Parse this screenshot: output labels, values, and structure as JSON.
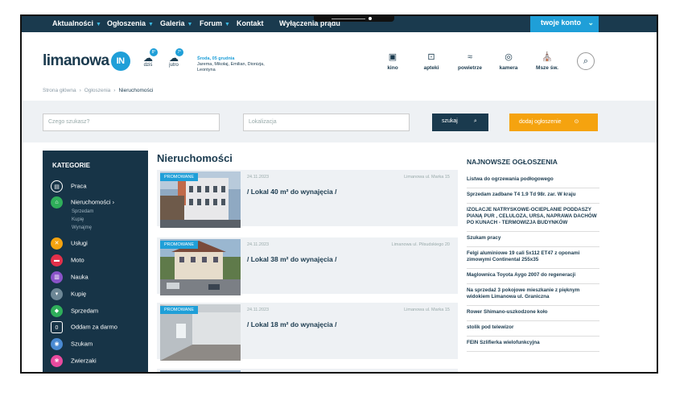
{
  "nav": {
    "items": [
      "Aktualności",
      "Ogłoszenia",
      "Galeria",
      "Forum",
      "Kontakt",
      "Wyłączenia prądu"
    ],
    "account": "twoje konto"
  },
  "header": {
    "logo_text": "limanowa",
    "logo_badge": "IN",
    "weather_today": {
      "label": "dziś",
      "temp": "8°"
    },
    "weather_tomorrow": {
      "label": "jutro",
      "temp": "7°"
    },
    "date": "Środa, 05 grudnia",
    "names": "Jarema, Mikołaj, Emilian, Dionizja, Leontyna",
    "icons": [
      {
        "label": "kino",
        "icon": "cinema-icon"
      },
      {
        "label": "apteki",
        "icon": "pharmacy-icon"
      },
      {
        "label": "powietrze",
        "icon": "air-icon"
      },
      {
        "label": "kamera",
        "icon": "camera-icon"
      },
      {
        "label": "Msze św.",
        "icon": "church-icon"
      }
    ]
  },
  "breadcrumb": {
    "home": "Strona główna",
    "section": "Ogłoszenia",
    "current": "Nieruchomości"
  },
  "search": {
    "query_placeholder": "Czego szukasz?",
    "location_placeholder": "Lokalizacja",
    "search_label": "szukaj",
    "add_label": "dodaj ogłoszenie"
  },
  "sidebar": {
    "title": "KATEGORIE",
    "items": [
      {
        "label": "Praca",
        "color": "#173447"
      },
      {
        "label": "Nieruchomości ›",
        "color": "#2fae5a"
      },
      {
        "label": "Usługi",
        "color": "#f5a30f"
      },
      {
        "label": "Moto",
        "color": "#e2304a"
      },
      {
        "label": "Nauka",
        "color": "#8a53c9"
      },
      {
        "label": "Kupię",
        "color": "#6d8796"
      },
      {
        "label": "Sprzedam",
        "color": "#2fae5a"
      },
      {
        "label": "Oddam za darmo",
        "color": "#173447"
      },
      {
        "label": "Szukam",
        "color": "#4a8ad2"
      },
      {
        "label": "Zwierzaki",
        "color": "#e84a9e"
      }
    ],
    "subitems": [
      "Sprzedam",
      "Kupię",
      "Wynajmę"
    ]
  },
  "main": {
    "title": "Nieruchomości",
    "listings": [
      {
        "promo": "PROMOWANE",
        "date": "24.11.2023",
        "location": "Limanowa ul. Marka 15",
        "title": "/ Lokal 40 m² do wynajęcia /"
      },
      {
        "promo": "PROMOWANE",
        "date": "24.11.2023",
        "location": "Limanowa ul. Piłsudskiego 20",
        "title": "/ Lokal 38 m² do wynajęcia /"
      },
      {
        "promo": "PROMOWANE",
        "date": "24.11.2023",
        "location": "Limanowa ul. Marka 15",
        "title": "/ Lokal 18 m² do wynajęcia /"
      }
    ]
  },
  "right": {
    "title": "NAJNOWSZE OGŁOSZENIA",
    "items": [
      "Listwa do ogrzewania podłogowego",
      "Sprzedam zadbane T4 1.9 Td 98r. zar. W kraju",
      "IZOLACJE NATRYSKOWE-OCIEPLANIE PODDASZY PIANĄ PUR , CELULOZA, URSA, NAPRAWA DACHÓW PO KUNACH - TERMOWIZJA BUDYNKÓW",
      "Szukam pracy",
      "Felgi aluminiowe 19 cali 5x112 ET47 z oponami zimowymi Continental 255x35",
      "Maglownica Toyota Aygo 2007 do regeneracji",
      "Na sprzedaż 3 pokojowe mieszkanie z pięknym widokiem Limanowa ul. Graniczna",
      "Rower Shimano-uszkodzone koło",
      "stolik pod telewizor",
      "FEIN Szlifierka wielofunkcyjna"
    ]
  }
}
